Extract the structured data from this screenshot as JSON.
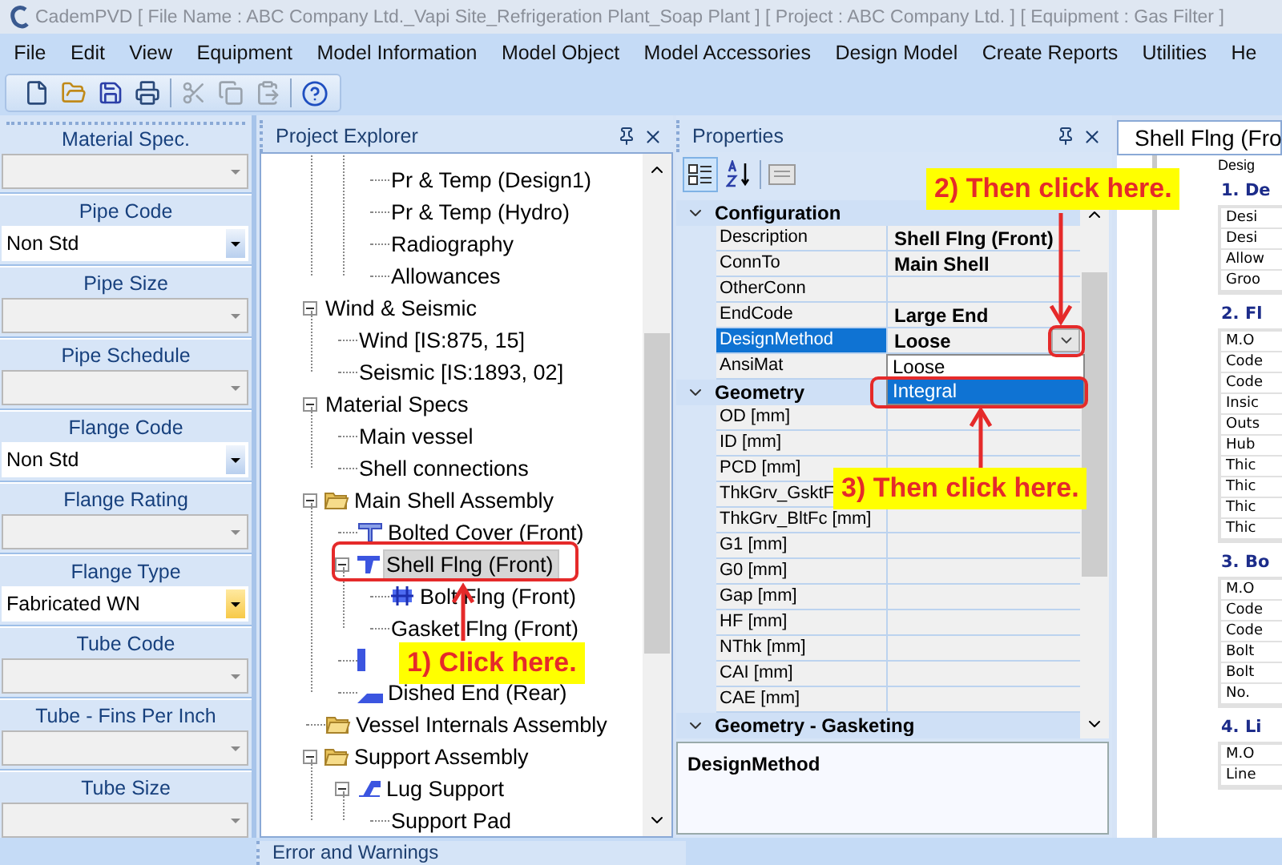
{
  "window": {
    "title": "CademPVD [ File Name : ABC Company Ltd._Vapi Site_Refrigeration Plant_Soap Plant ] [ Project : ABC Company Ltd. ] [ Equipment : Gas Filter ]"
  },
  "menu": [
    "File",
    "Edit",
    "View",
    "Equipment",
    "Model Information",
    "Model Object",
    "Model Accessories",
    "Design Model",
    "Create Reports",
    "Utilities",
    "He"
  ],
  "selectors": [
    {
      "label": "Material Spec.",
      "enabled": false,
      "focused": false
    },
    {
      "label": "Pipe Code",
      "value": "Non Std",
      "enabled": true,
      "focused": false
    },
    {
      "label": "Pipe Size",
      "enabled": false,
      "focused": false
    },
    {
      "label": "Pipe Schedule",
      "enabled": false,
      "focused": false
    },
    {
      "label": "Flange Code",
      "value": "Non Std",
      "enabled": true,
      "focused": false
    },
    {
      "label": "Flange Rating",
      "enabled": false,
      "focused": false
    },
    {
      "label": "Flange Type",
      "value": "Fabricated WN",
      "enabled": true,
      "focused": true
    },
    {
      "label": "Tube Code",
      "enabled": false,
      "focused": false
    },
    {
      "label": "Tube - Fins Per Inch",
      "enabled": false,
      "focused": false
    },
    {
      "label": "Tube Size",
      "enabled": false,
      "focused": false
    }
  ],
  "explorer": {
    "title": "Project Explorer",
    "tree": [
      {
        "children": [
          {
            "children": [
              {
                "label": "Pr & Temp (Design1)",
                "selected": false
              },
              {
                "label": "Pr & Temp (Hydro)",
                "selected": false
              },
              {
                "label": "Radiography",
                "selected": false
              },
              {
                "label": "Allowances",
                "selected": false
              }
            ]
          }
        ]
      },
      {
        "label": "Wind & Seismic",
        "selected": false,
        "expanded": true,
        "children": [
          {
            "label": "Wind [IS:875, 15]",
            "selected": false
          },
          {
            "label": "Seismic [IS:1893, 02]",
            "selected": false
          }
        ]
      },
      {
        "label": "Material Specs",
        "selected": false,
        "expanded": true,
        "children": [
          {
            "label": "Main vessel",
            "selected": false
          },
          {
            "label": "Shell connections",
            "selected": false
          }
        ]
      },
      {
        "label": "Main Shell Assembly",
        "kind": "folder",
        "selected": false,
        "expanded": true,
        "children": [
          {
            "label": "Bolted Cover (Front)",
            "kind": "cover",
            "selected": false
          },
          {
            "label": "Shell Flng (Front)",
            "kind": "flange",
            "selected": true,
            "expanded": true,
            "children": [
              {
                "label": "Bolt Flng (Front)",
                "kind": "bolt",
                "selected": false
              },
              {
                "label": "Gasket Flng (Front)",
                "selected": false
              }
            ]
          },
          {
            "kind": "part"
          },
          {
            "label": "Dished End (Rear)",
            "kind": "head",
            "selected": false
          }
        ]
      },
      {
        "label": "Vessel Internals Assembly",
        "kind": "folder",
        "selected": false
      },
      {
        "label": "Support Assembly",
        "kind": "folder",
        "selected": false,
        "expanded": true,
        "children": [
          {
            "label": "Lug Support",
            "kind": "lug",
            "selected": false,
            "expanded": true,
            "children": [
              {
                "label": "Support Pad",
                "selected": false
              }
            ]
          }
        ]
      }
    ]
  },
  "properties": {
    "title": "Properties",
    "groups": [
      {
        "name": "Configuration",
        "expanded": true,
        "rows": [
          {
            "name": "Description",
            "value": "Shell Flng (Front)",
            "selected": false
          },
          {
            "name": "ConnTo",
            "value": "Main Shell",
            "selected": false
          },
          {
            "name": "OtherConn",
            "selected": false
          },
          {
            "name": "EndCode",
            "value": "Large End",
            "selected": false
          },
          {
            "name": "DesignMethod",
            "value": "Loose",
            "selected": true
          },
          {
            "name": "AnsiMat",
            "selected": false
          }
        ]
      },
      {
        "name": "Geometry",
        "expanded": true,
        "rows": [
          {
            "name": "OD [mm]",
            "selected": false
          },
          {
            "name": "ID [mm]",
            "selected": false
          },
          {
            "name": "PCD [mm]",
            "selected": false
          },
          {
            "name": "ThkGrv_GsktF",
            "selected": false
          },
          {
            "name": "ThkGrv_BltFc [mm]",
            "selected": false
          },
          {
            "name": "G1 [mm]",
            "selected": false
          },
          {
            "name": "G0 [mm]",
            "selected": false
          },
          {
            "name": "Gap [mm]",
            "selected": false
          },
          {
            "name": "HF [mm]",
            "selected": false
          },
          {
            "name": "NThk [mm]",
            "selected": false
          },
          {
            "name": "CAI [mm]",
            "selected": false
          },
          {
            "name": "CAE [mm]",
            "selected": false
          }
        ]
      },
      {
        "name": "Geometry - Gasketing",
        "expanded": true
      }
    ],
    "dropdown": {
      "options": [
        {
          "label": "Loose",
          "selected": false
        },
        {
          "label": "Integral",
          "selected": true
        }
      ]
    },
    "description": {
      "title": "DesignMethod"
    }
  },
  "document": {
    "tab": "Shell Flng (Fro",
    "caption": "Desig",
    "sections": [
      {
        "title": "1. De",
        "rows": [
          "Desi",
          "Desi",
          "Allow",
          "Groo"
        ]
      },
      {
        "title": "2. Fl",
        "rows": [
          "M.O",
          "Code",
          "Code",
          "Insic",
          "Outs",
          "Hub",
          "Thic",
          "Thic",
          "Thic",
          "Thic"
        ]
      },
      {
        "title": "3. Bo",
        "rows": [
          "M.O",
          "Code",
          "Code",
          "Bolt",
          "Bolt",
          "No."
        ]
      },
      {
        "title": "4. Li",
        "rows": [
          "M.O",
          "Line"
        ]
      }
    ]
  },
  "errors_panel": {
    "title": "Error and Warnings"
  },
  "annotations": [
    {
      "text": "1) Click here."
    },
    {
      "text": "2) Then click here."
    },
    {
      "text": "3) Then click here."
    }
  ]
}
